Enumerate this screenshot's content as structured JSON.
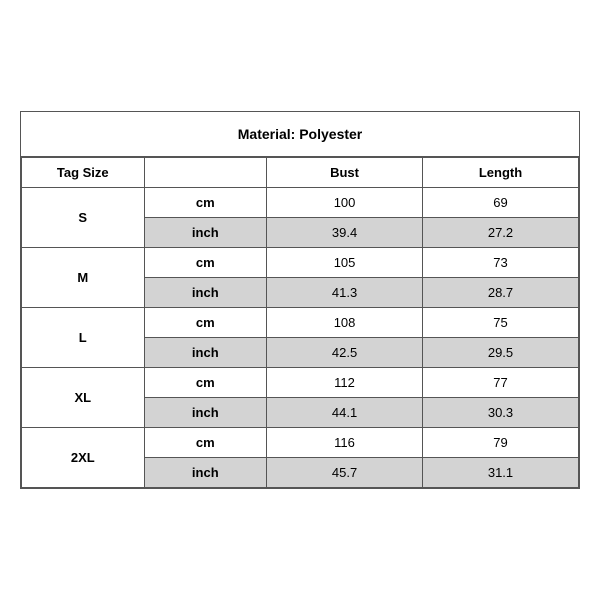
{
  "title": "Material: Polyester",
  "headers": {
    "tag_size": "Tag Size",
    "bust": "Bust",
    "length": "Length"
  },
  "sizes": [
    {
      "tag": "S",
      "cm": {
        "bust": "100",
        "length": "69"
      },
      "inch": {
        "bust": "39.4",
        "length": "27.2"
      }
    },
    {
      "tag": "M",
      "cm": {
        "bust": "105",
        "length": "73"
      },
      "inch": {
        "bust": "41.3",
        "length": "28.7"
      }
    },
    {
      "tag": "L",
      "cm": {
        "bust": "108",
        "length": "75"
      },
      "inch": {
        "bust": "42.5",
        "length": "29.5"
      }
    },
    {
      "tag": "XL",
      "cm": {
        "bust": "112",
        "length": "77"
      },
      "inch": {
        "bust": "44.1",
        "length": "30.3"
      }
    },
    {
      "tag": "2XL",
      "cm": {
        "bust": "116",
        "length": "79"
      },
      "inch": {
        "bust": "45.7",
        "length": "31.1"
      }
    }
  ],
  "unit_cm": "cm",
  "unit_inch": "inch"
}
